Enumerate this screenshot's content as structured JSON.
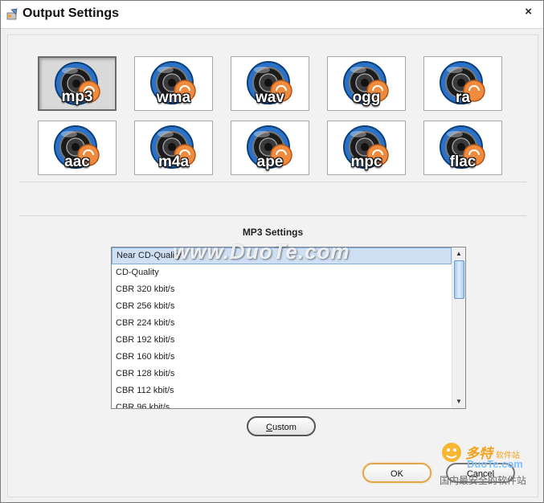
{
  "window": {
    "title": "Output Settings",
    "close_label": "×"
  },
  "formats": [
    {
      "label": "mp3",
      "selected": true
    },
    {
      "label": "wma",
      "selected": false
    },
    {
      "label": "wav",
      "selected": false
    },
    {
      "label": "ogg",
      "selected": false
    },
    {
      "label": "ra",
      "selected": false
    },
    {
      "label": "aac",
      "selected": false
    },
    {
      "label": "m4a",
      "selected": false
    },
    {
      "label": "ape",
      "selected": false
    },
    {
      "label": "mpc",
      "selected": false
    },
    {
      "label": "flac",
      "selected": false
    }
  ],
  "settings": {
    "title": "MP3 Settings",
    "items": [
      "Near CD-Quality",
      "CD-Quality",
      "CBR 320 kbit/s",
      "CBR 256 kbit/s",
      "CBR 224 kbit/s",
      "CBR 192 kbit/s",
      "CBR 160 kbit/s",
      "CBR 128 kbit/s",
      "CBR 112 kbit/s",
      "CBR 96 kbit/s"
    ],
    "selected_index": 0
  },
  "buttons": {
    "custom_rest": "ustom",
    "custom_mnemonic": "C",
    "ok": "OK",
    "cancel": "Cancel"
  },
  "watermark": "www.DuoTe.com",
  "logo": {
    "top": "多特",
    "sub": "软件站",
    "domain": "DuoTe.com",
    "bottom": "国内最安全的软件站"
  },
  "colors": {
    "accent_blue": "#2a72c8",
    "orange": "#f08a3c",
    "selection": "#cfe0f5",
    "ok_border": "#e0a84a"
  }
}
